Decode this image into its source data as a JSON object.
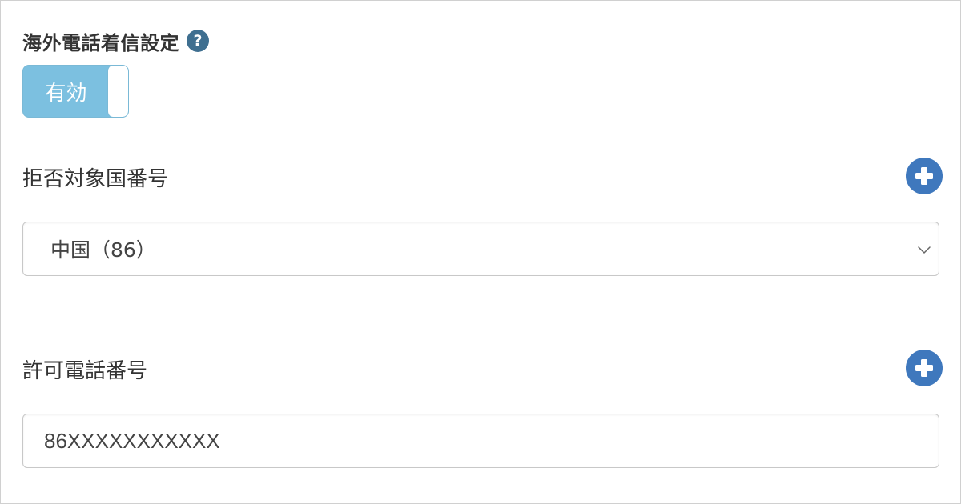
{
  "international_call_settings": {
    "title": "海外電話着信設定",
    "help_icon": "question-circle",
    "help_glyph": "?",
    "toggle": {
      "label": "有効",
      "enabled": true
    }
  },
  "rejected_country_codes": {
    "label": "拒否対象国番号",
    "add_icon": "plus-circle",
    "selected_value": "中国（86）"
  },
  "allowed_phone_numbers": {
    "label": "許可電話番号",
    "add_icon": "plus-circle",
    "input_value": "86XXXXXXXXXXX"
  },
  "colors": {
    "toggle_on": "#7cc0e0",
    "add_button": "#3f78bd",
    "help_icon": "#3f6f90"
  }
}
